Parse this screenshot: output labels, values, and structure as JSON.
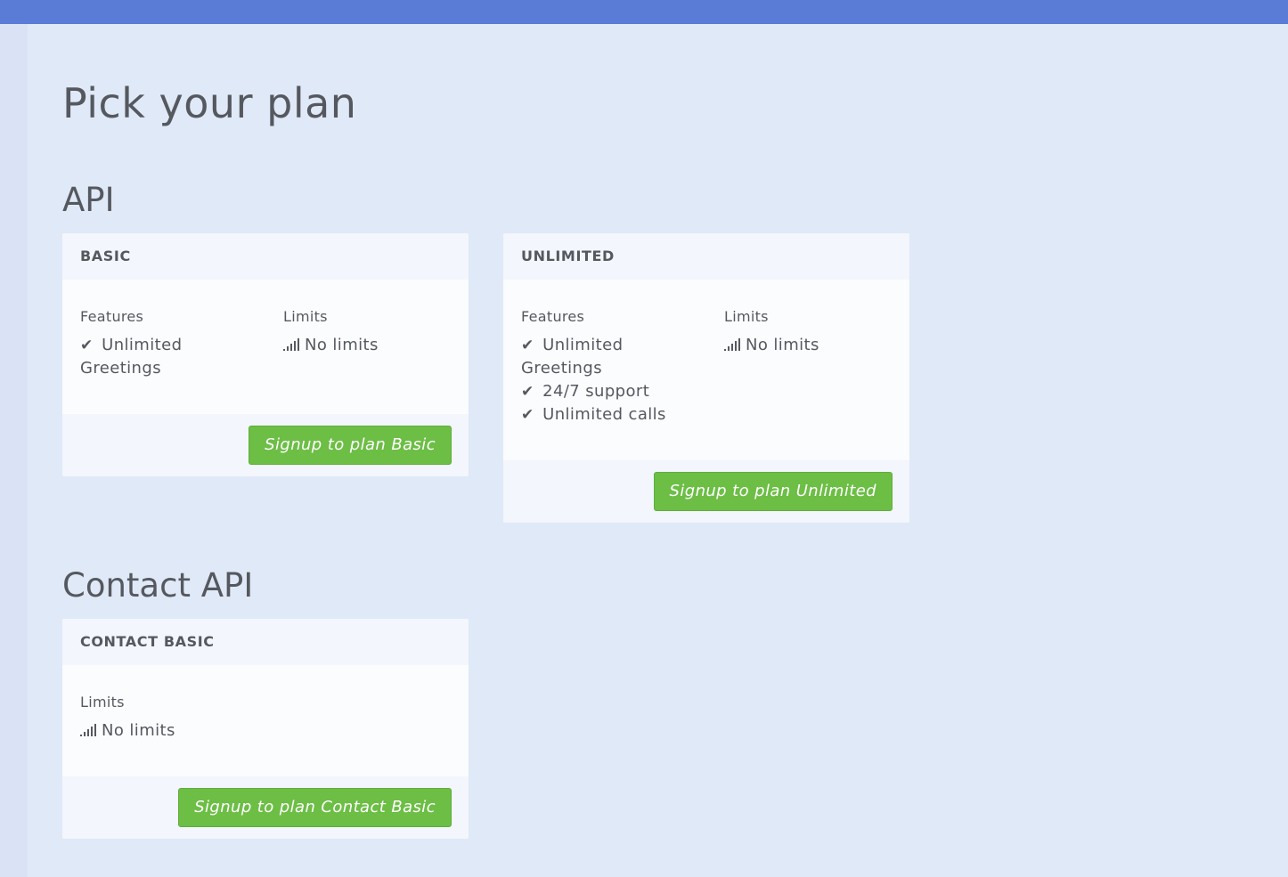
{
  "page": {
    "title": "Pick your plan"
  },
  "sections": [
    {
      "title": "API",
      "plans": [
        {
          "name": "BASIC",
          "features_title": "Features",
          "features": [
            "Unlimited Greetings"
          ],
          "limits_title": "Limits",
          "limits": [
            "No limits"
          ],
          "button": "Signup to plan Basic"
        },
        {
          "name": "UNLIMITED",
          "features_title": "Features",
          "features": [
            "Unlimited Greetings",
            "24/7 support",
            "Unlimited calls"
          ],
          "limits_title": "Limits",
          "limits": [
            "No limits"
          ],
          "button": "Signup to plan Unlimited"
        }
      ]
    },
    {
      "title": "Contact API",
      "plans": [
        {
          "name": "CONTACT BASIC",
          "limits_title": "Limits",
          "limits": [
            "No limits"
          ],
          "button": "Signup to plan Contact Basic"
        }
      ]
    }
  ],
  "icons": {
    "feature": "check-icon",
    "limit": "signal-bars-icon"
  },
  "colors": {
    "topbar": "#5a7bd6",
    "background": "#e0e9f7",
    "button": "#6cbe45",
    "text": "#55595f"
  }
}
